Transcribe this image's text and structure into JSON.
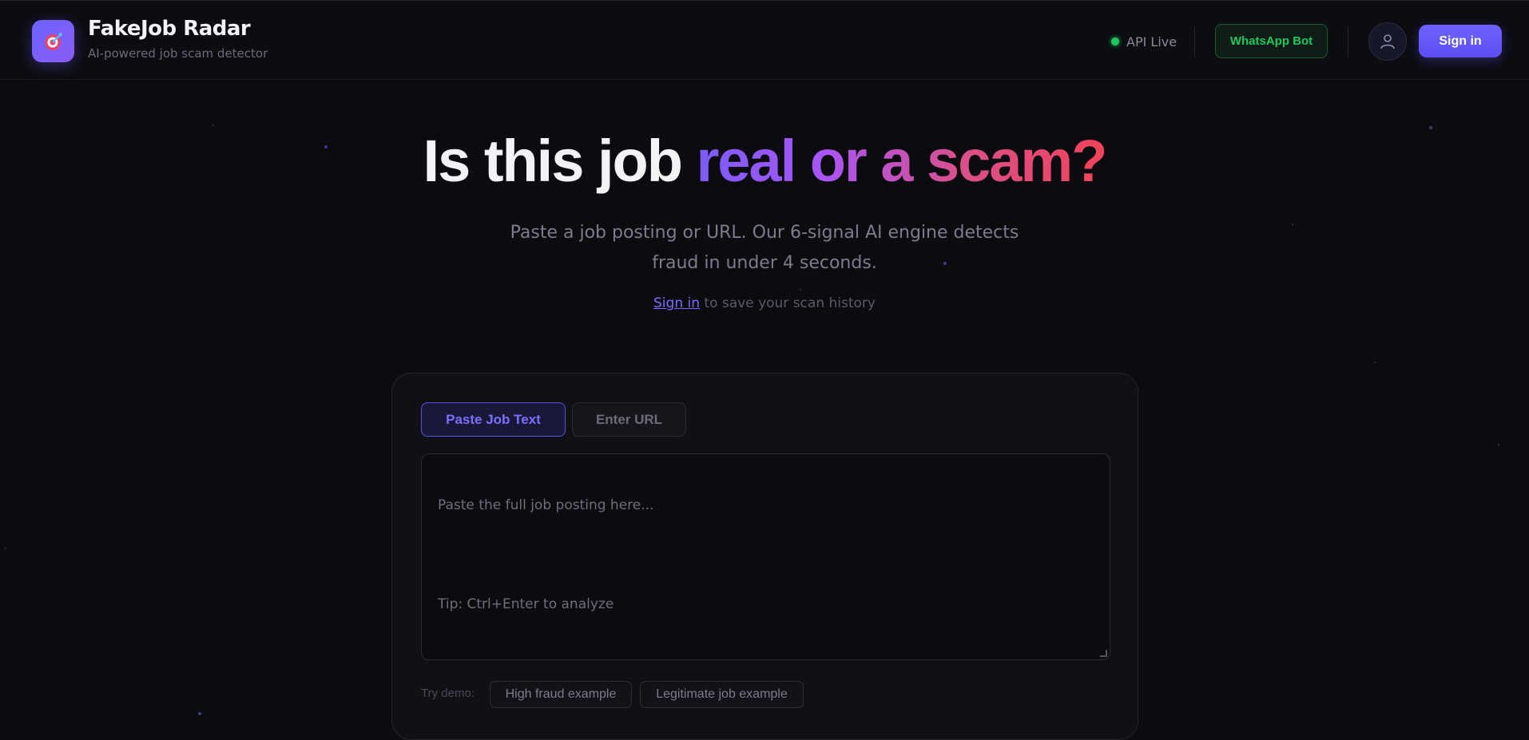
{
  "brand": {
    "title": "FakeJob Radar",
    "subtitle": "AI-powered job scam detector",
    "logo_icon": "target-icon"
  },
  "header": {
    "api_status": "API Live",
    "whatsapp_label": "WhatsApp Bot",
    "signin_label": "Sign in",
    "avatar_icon": "user-icon",
    "colors": {
      "live": "#22c55e",
      "accent": "#6366f1"
    }
  },
  "hero": {
    "title_plain": "Is this job ",
    "title_gradient": "real or a scam?",
    "subtitle_line1": "Paste a job posting or URL. Our 6-signal AI engine detects",
    "subtitle_line2": "fraud in under 4 seconds.",
    "signin_link": "Sign in",
    "signin_rest": " to save your scan history"
  },
  "card": {
    "tabs": [
      {
        "label": "Paste Job Text",
        "active": true
      },
      {
        "label": "Enter URL",
        "active": false
      }
    ],
    "textarea_placeholder_line1": "Paste the full job posting here...",
    "textarea_placeholder_line2": "Tip: Ctrl+Enter to analyze",
    "demo_label": "Try demo:",
    "demo_buttons": [
      "High fraud example",
      "Legitimate job example"
    ]
  }
}
